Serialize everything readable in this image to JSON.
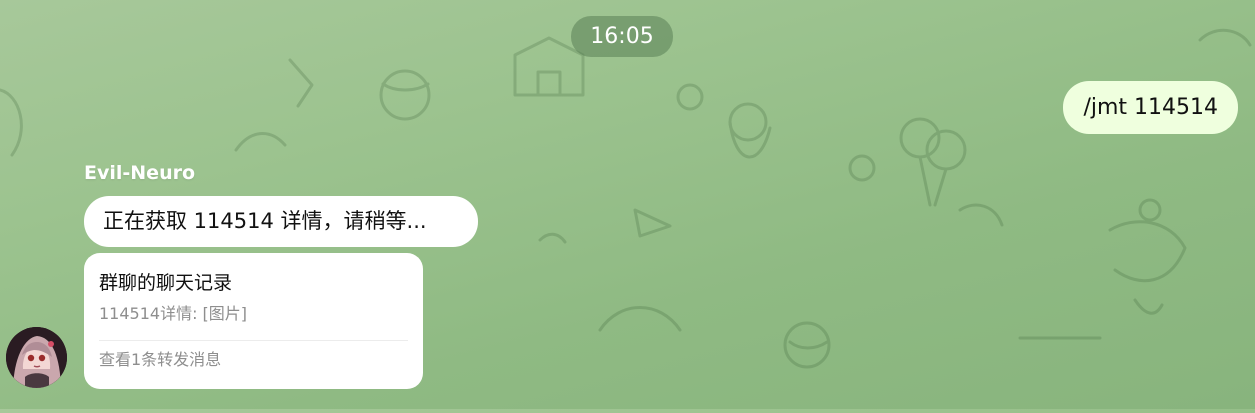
{
  "chat": {
    "timestamp": "16:05",
    "outgoing": {
      "text": "/jmt 114514"
    },
    "incoming": {
      "sender_name": "Evil-Neuro",
      "message_text": "正在获取 114514 详情，请稍等...",
      "forward_card": {
        "title": "群聊的聊天记录",
        "summary": "114514详情: [图片]",
        "footer": "查看1条转发消息"
      },
      "avatar_icon": "anime-girl-avatar"
    }
  },
  "colors": {
    "background": "#9cc38f",
    "outgoing_bubble": "#efffde",
    "incoming_bubble": "#ffffff",
    "timestamp_pill": "#6f9468"
  }
}
